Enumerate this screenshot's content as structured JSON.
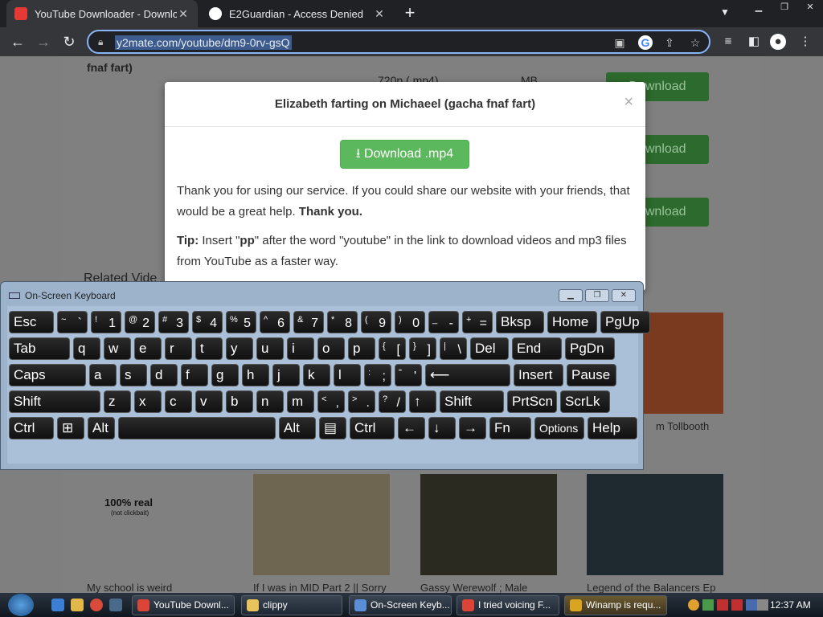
{
  "browser": {
    "tabs": [
      {
        "title": "YouTube Downloader - Downloa",
        "active": true
      },
      {
        "title": "E2Guardian - Access Denied",
        "active": false
      }
    ],
    "new_tab": "+",
    "address": "y2mate.com/youtube/dm9-0rv-gsQ"
  },
  "background_page": {
    "video_label": "fnaf fart)",
    "quality": "720p (.mp4)",
    "size": "MB",
    "download_label": "Download",
    "related_heading": "Related Vide",
    "side_caption": "m Tollbooth",
    "videos": [
      {
        "caption": "My school is weird",
        "thumb_text": "100% real",
        "thumb_sub": "(not clickbait)"
      },
      {
        "caption": "If I was in MID Part 2 || Sorry"
      },
      {
        "caption": "Gassy Werewolf ; Male"
      },
      {
        "caption": "Legend of the Balancers Ep"
      }
    ]
  },
  "modal": {
    "title": "Elizabeth farting on Michaeel (gacha fnaf fart)",
    "close": "×",
    "download_button": "Download .mp4",
    "thanks_text": "Thank you for using our service. If you could share our website with your friends, that would be a great help.",
    "thanks_bold": "Thank you.",
    "tip_label": "Tip:",
    "tip_text_1": "Insert \"",
    "tip_keyword": "pp",
    "tip_text_2": "\" after the word \"youtube\" in the link to download videos and mp3 files from YouTube as a faster way."
  },
  "osk": {
    "title": "On-Screen Keyboard",
    "rows": [
      [
        {
          "label": "Esc"
        },
        {
          "shift": "~",
          "main": "`"
        },
        {
          "shift": "!",
          "main": "1"
        },
        {
          "shift": "@",
          "main": "2"
        },
        {
          "shift": "#",
          "main": "3"
        },
        {
          "shift": "$",
          "main": "4"
        },
        {
          "shift": "%",
          "main": "5"
        },
        {
          "shift": "^",
          "main": "6"
        },
        {
          "shift": "&",
          "main": "7"
        },
        {
          "shift": "*",
          "main": "8"
        },
        {
          "shift": "(",
          "main": "9"
        },
        {
          "shift": ")",
          "main": "0"
        },
        {
          "shift": "_",
          "main": "-"
        },
        {
          "shift": "+",
          "main": "="
        },
        {
          "label": "Bksp"
        },
        {
          "label": "Home"
        },
        {
          "label": "PgUp"
        }
      ],
      [
        {
          "label": "Tab"
        },
        {
          "label": "q"
        },
        {
          "label": "w"
        },
        {
          "label": "e"
        },
        {
          "label": "r"
        },
        {
          "label": "t"
        },
        {
          "label": "y"
        },
        {
          "label": "u"
        },
        {
          "label": "i"
        },
        {
          "label": "o"
        },
        {
          "label": "p"
        },
        {
          "shift": "{",
          "main": "["
        },
        {
          "shift": "}",
          "main": "]"
        },
        {
          "shift": "|",
          "main": "\\"
        },
        {
          "label": "Del"
        },
        {
          "label": "End"
        },
        {
          "label": "PgDn"
        }
      ],
      [
        {
          "label": "Caps"
        },
        {
          "label": "a"
        },
        {
          "label": "s"
        },
        {
          "label": "d"
        },
        {
          "label": "f"
        },
        {
          "label": "g"
        },
        {
          "label": "h"
        },
        {
          "label": "j"
        },
        {
          "label": "k"
        },
        {
          "label": "l"
        },
        {
          "shift": ":",
          "main": ";"
        },
        {
          "shift": "\"",
          "main": "'"
        },
        {
          "label": "⟵"
        },
        {
          "label": "Insert"
        },
        {
          "label": "Pause"
        }
      ],
      [
        {
          "label": "Shift"
        },
        {
          "label": "z"
        },
        {
          "label": "x"
        },
        {
          "label": "c"
        },
        {
          "label": "v"
        },
        {
          "label": "b"
        },
        {
          "label": "n"
        },
        {
          "label": "m"
        },
        {
          "shift": "<",
          "main": ","
        },
        {
          "shift": ">",
          "main": "."
        },
        {
          "shift": "?",
          "main": "/"
        },
        {
          "label": "↑"
        },
        {
          "label": "Shift"
        },
        {
          "label": "PrtScn"
        },
        {
          "label": "ScrLk"
        }
      ],
      [
        {
          "label": "Ctrl"
        },
        {
          "label": "⊞"
        },
        {
          "label": "Alt"
        },
        {
          "label": ""
        },
        {
          "label": "Alt"
        },
        {
          "label": "▤"
        },
        {
          "label": "Ctrl"
        },
        {
          "label": "←"
        },
        {
          "label": "↓"
        },
        {
          "label": "→"
        },
        {
          "label": "Fn"
        },
        {
          "label": "Options"
        },
        {
          "label": "Help"
        }
      ]
    ]
  },
  "taskbar": {
    "tasks": [
      {
        "label": "YouTube Downl...",
        "color": "#db4437"
      },
      {
        "label": "clippy",
        "color": "#e8c45a"
      },
      {
        "label": "On-Screen Keyb...",
        "color": "#5a8ed6"
      },
      {
        "label": "I tried voicing F...",
        "color": "#db4437"
      },
      {
        "label": "Winamp is requ...",
        "color": "#d9a520"
      }
    ],
    "clock": "12:37 AM"
  },
  "colors": {
    "accent": "#8ab4f8",
    "download_green": "#5cb85c"
  }
}
